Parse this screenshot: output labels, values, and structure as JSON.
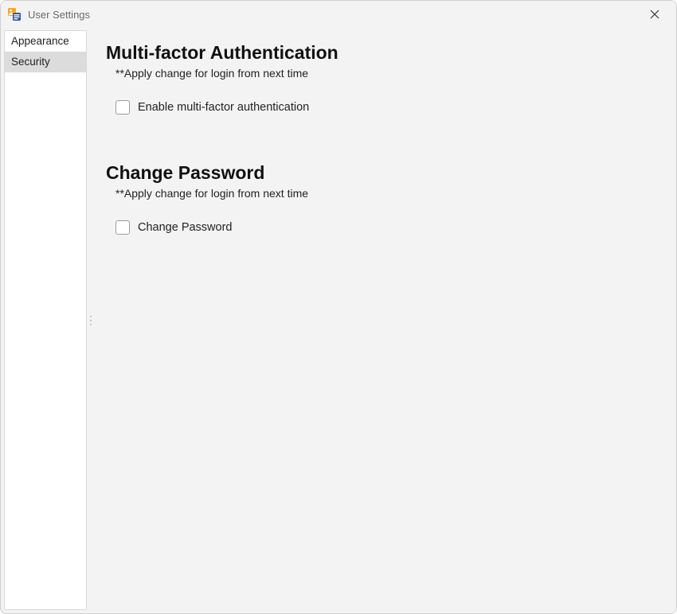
{
  "window": {
    "title": "User Settings"
  },
  "sidebar": {
    "items": [
      {
        "label": "Appearance",
        "selected": false
      },
      {
        "label": "Security",
        "selected": true
      }
    ]
  },
  "content": {
    "sections": [
      {
        "heading": "Multi-factor Authentication",
        "note": "**Apply change for login from next time",
        "checkbox_label": "Enable multi-factor authentication",
        "checked": false
      },
      {
        "heading": "Change Password",
        "note": "**Apply change for login from next time",
        "checkbox_label": "Change Password",
        "checked": false
      }
    ]
  }
}
